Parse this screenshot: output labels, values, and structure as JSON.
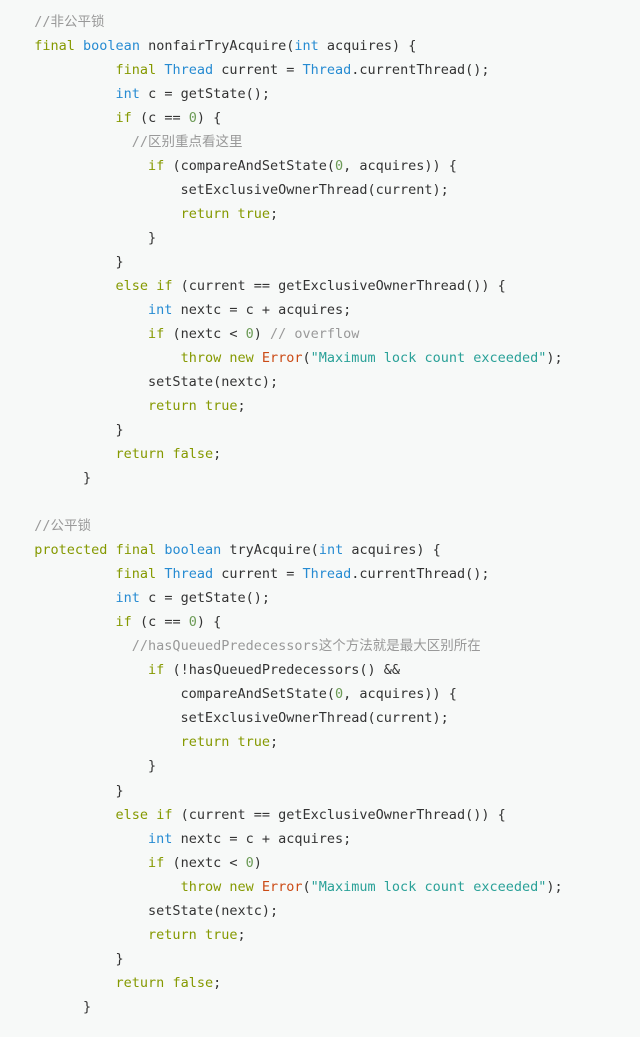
{
  "code": {
    "tokens": [
      {
        "cls": "c-comment",
        "txt": "  //非公平锁\n"
      },
      {
        "cls": "",
        "txt": "  "
      },
      {
        "cls": "c-keyword",
        "txt": "final"
      },
      {
        "cls": "",
        "txt": " "
      },
      {
        "cls": "c-type",
        "txt": "boolean"
      },
      {
        "cls": "",
        "txt": " "
      },
      {
        "cls": "c-func",
        "txt": "nonfairTryAcquire"
      },
      {
        "cls": "",
        "txt": "("
      },
      {
        "cls": "c-type",
        "txt": "int"
      },
      {
        "cls": "",
        "txt": " acquires) {\n"
      },
      {
        "cls": "",
        "txt": "            "
      },
      {
        "cls": "c-keyword",
        "txt": "final"
      },
      {
        "cls": "",
        "txt": " "
      },
      {
        "cls": "c-type",
        "txt": "Thread"
      },
      {
        "cls": "",
        "txt": " current = "
      },
      {
        "cls": "c-type",
        "txt": "Thread"
      },
      {
        "cls": "",
        "txt": ".currentThread();\n"
      },
      {
        "cls": "",
        "txt": "            "
      },
      {
        "cls": "c-type",
        "txt": "int"
      },
      {
        "cls": "",
        "txt": " c = getState();\n"
      },
      {
        "cls": "",
        "txt": "            "
      },
      {
        "cls": "c-keyword",
        "txt": "if"
      },
      {
        "cls": "",
        "txt": " (c == "
      },
      {
        "cls": "c-num",
        "txt": "0"
      },
      {
        "cls": "",
        "txt": ") {\n"
      },
      {
        "cls": "",
        "txt": "              "
      },
      {
        "cls": "c-comment",
        "txt": "//区别重点看这里"
      },
      {
        "cls": "",
        "txt": "\n"
      },
      {
        "cls": "",
        "txt": "                "
      },
      {
        "cls": "c-keyword",
        "txt": "if"
      },
      {
        "cls": "",
        "txt": " (compareAndSetState("
      },
      {
        "cls": "c-num",
        "txt": "0"
      },
      {
        "cls": "",
        "txt": ", acquires)) {\n"
      },
      {
        "cls": "",
        "txt": "                    setExclusiveOwnerThread(current);\n"
      },
      {
        "cls": "",
        "txt": "                    "
      },
      {
        "cls": "c-keyword",
        "txt": "return"
      },
      {
        "cls": "",
        "txt": " "
      },
      {
        "cls": "c-keyword",
        "txt": "true"
      },
      {
        "cls": "",
        "txt": ";\n"
      },
      {
        "cls": "",
        "txt": "                }\n"
      },
      {
        "cls": "",
        "txt": "            }\n"
      },
      {
        "cls": "",
        "txt": "            "
      },
      {
        "cls": "c-keyword",
        "txt": "else"
      },
      {
        "cls": "",
        "txt": " "
      },
      {
        "cls": "c-keyword",
        "txt": "if"
      },
      {
        "cls": "",
        "txt": " (current == getExclusiveOwnerThread()) {\n"
      },
      {
        "cls": "",
        "txt": "                "
      },
      {
        "cls": "c-type",
        "txt": "int"
      },
      {
        "cls": "",
        "txt": " nextc = c + acquires;\n"
      },
      {
        "cls": "",
        "txt": "                "
      },
      {
        "cls": "c-keyword",
        "txt": "if"
      },
      {
        "cls": "",
        "txt": " (nextc < "
      },
      {
        "cls": "c-num",
        "txt": "0"
      },
      {
        "cls": "",
        "txt": ") "
      },
      {
        "cls": "c-comment",
        "txt": "// overflow"
      },
      {
        "cls": "",
        "txt": "\n"
      },
      {
        "cls": "",
        "txt": "                    "
      },
      {
        "cls": "c-keyword",
        "txt": "throw"
      },
      {
        "cls": "",
        "txt": " "
      },
      {
        "cls": "c-keyword",
        "txt": "new"
      },
      {
        "cls": "",
        "txt": " "
      },
      {
        "cls": "c-err",
        "txt": "Error"
      },
      {
        "cls": "",
        "txt": "("
      },
      {
        "cls": "c-str",
        "txt": "\"Maximum lock count exceeded\""
      },
      {
        "cls": "",
        "txt": ");\n"
      },
      {
        "cls": "",
        "txt": "                setState(nextc);\n"
      },
      {
        "cls": "",
        "txt": "                "
      },
      {
        "cls": "c-keyword",
        "txt": "return"
      },
      {
        "cls": "",
        "txt": " "
      },
      {
        "cls": "c-keyword",
        "txt": "true"
      },
      {
        "cls": "",
        "txt": ";\n"
      },
      {
        "cls": "",
        "txt": "            }\n"
      },
      {
        "cls": "",
        "txt": "            "
      },
      {
        "cls": "c-keyword",
        "txt": "return"
      },
      {
        "cls": "",
        "txt": " "
      },
      {
        "cls": "c-keyword",
        "txt": "false"
      },
      {
        "cls": "",
        "txt": ";\n"
      },
      {
        "cls": "",
        "txt": "        }\n"
      },
      {
        "cls": "",
        "txt": "\n"
      },
      {
        "cls": "c-comment",
        "txt": "  //公平锁\n"
      },
      {
        "cls": "",
        "txt": "  "
      },
      {
        "cls": "c-keyword",
        "txt": "protected"
      },
      {
        "cls": "",
        "txt": " "
      },
      {
        "cls": "c-keyword",
        "txt": "final"
      },
      {
        "cls": "",
        "txt": " "
      },
      {
        "cls": "c-type",
        "txt": "boolean"
      },
      {
        "cls": "",
        "txt": " "
      },
      {
        "cls": "c-func",
        "txt": "tryAcquire"
      },
      {
        "cls": "",
        "txt": "("
      },
      {
        "cls": "c-type",
        "txt": "int"
      },
      {
        "cls": "",
        "txt": " acquires) {\n"
      },
      {
        "cls": "",
        "txt": "            "
      },
      {
        "cls": "c-keyword",
        "txt": "final"
      },
      {
        "cls": "",
        "txt": " "
      },
      {
        "cls": "c-type",
        "txt": "Thread"
      },
      {
        "cls": "",
        "txt": " current = "
      },
      {
        "cls": "c-type",
        "txt": "Thread"
      },
      {
        "cls": "",
        "txt": ".currentThread();\n"
      },
      {
        "cls": "",
        "txt": "            "
      },
      {
        "cls": "c-type",
        "txt": "int"
      },
      {
        "cls": "",
        "txt": " c = getState();\n"
      },
      {
        "cls": "",
        "txt": "            "
      },
      {
        "cls": "c-keyword",
        "txt": "if"
      },
      {
        "cls": "",
        "txt": " (c == "
      },
      {
        "cls": "c-num",
        "txt": "0"
      },
      {
        "cls": "",
        "txt": ") {\n"
      },
      {
        "cls": "",
        "txt": "              "
      },
      {
        "cls": "c-comment",
        "txt": "//hasQueuedPredecessors这个方法就是最大区别所在"
      },
      {
        "cls": "",
        "txt": "\n"
      },
      {
        "cls": "",
        "txt": "                "
      },
      {
        "cls": "c-keyword",
        "txt": "if"
      },
      {
        "cls": "",
        "txt": " (!hasQueuedPredecessors() &&\n"
      },
      {
        "cls": "",
        "txt": "                    compareAndSetState("
      },
      {
        "cls": "c-num",
        "txt": "0"
      },
      {
        "cls": "",
        "txt": ", acquires)) {\n"
      },
      {
        "cls": "",
        "txt": "                    setExclusiveOwnerThread(current);\n"
      },
      {
        "cls": "",
        "txt": "                    "
      },
      {
        "cls": "c-keyword",
        "txt": "return"
      },
      {
        "cls": "",
        "txt": " "
      },
      {
        "cls": "c-keyword",
        "txt": "true"
      },
      {
        "cls": "",
        "txt": ";\n"
      },
      {
        "cls": "",
        "txt": "                }\n"
      },
      {
        "cls": "",
        "txt": "            }\n"
      },
      {
        "cls": "",
        "txt": "            "
      },
      {
        "cls": "c-keyword",
        "txt": "else"
      },
      {
        "cls": "",
        "txt": " "
      },
      {
        "cls": "c-keyword",
        "txt": "if"
      },
      {
        "cls": "",
        "txt": " (current == getExclusiveOwnerThread()) {\n"
      },
      {
        "cls": "",
        "txt": "                "
      },
      {
        "cls": "c-type",
        "txt": "int"
      },
      {
        "cls": "",
        "txt": " nextc = c + acquires;\n"
      },
      {
        "cls": "",
        "txt": "                "
      },
      {
        "cls": "c-keyword",
        "txt": "if"
      },
      {
        "cls": "",
        "txt": " (nextc < "
      },
      {
        "cls": "c-num",
        "txt": "0"
      },
      {
        "cls": "",
        "txt": ")\n"
      },
      {
        "cls": "",
        "txt": "                    "
      },
      {
        "cls": "c-keyword",
        "txt": "throw"
      },
      {
        "cls": "",
        "txt": " "
      },
      {
        "cls": "c-keyword",
        "txt": "new"
      },
      {
        "cls": "",
        "txt": " "
      },
      {
        "cls": "c-err",
        "txt": "Error"
      },
      {
        "cls": "",
        "txt": "("
      },
      {
        "cls": "c-str",
        "txt": "\"Maximum lock count exceeded\""
      },
      {
        "cls": "",
        "txt": ");\n"
      },
      {
        "cls": "",
        "txt": "                setState(nextc);\n"
      },
      {
        "cls": "",
        "txt": "                "
      },
      {
        "cls": "c-keyword",
        "txt": "return"
      },
      {
        "cls": "",
        "txt": " "
      },
      {
        "cls": "c-keyword",
        "txt": "true"
      },
      {
        "cls": "",
        "txt": ";\n"
      },
      {
        "cls": "",
        "txt": "            }\n"
      },
      {
        "cls": "",
        "txt": "            "
      },
      {
        "cls": "c-keyword",
        "txt": "return"
      },
      {
        "cls": "",
        "txt": " "
      },
      {
        "cls": "c-keyword",
        "txt": "false"
      },
      {
        "cls": "",
        "txt": ";\n"
      },
      {
        "cls": "",
        "txt": "        }\n"
      }
    ]
  }
}
